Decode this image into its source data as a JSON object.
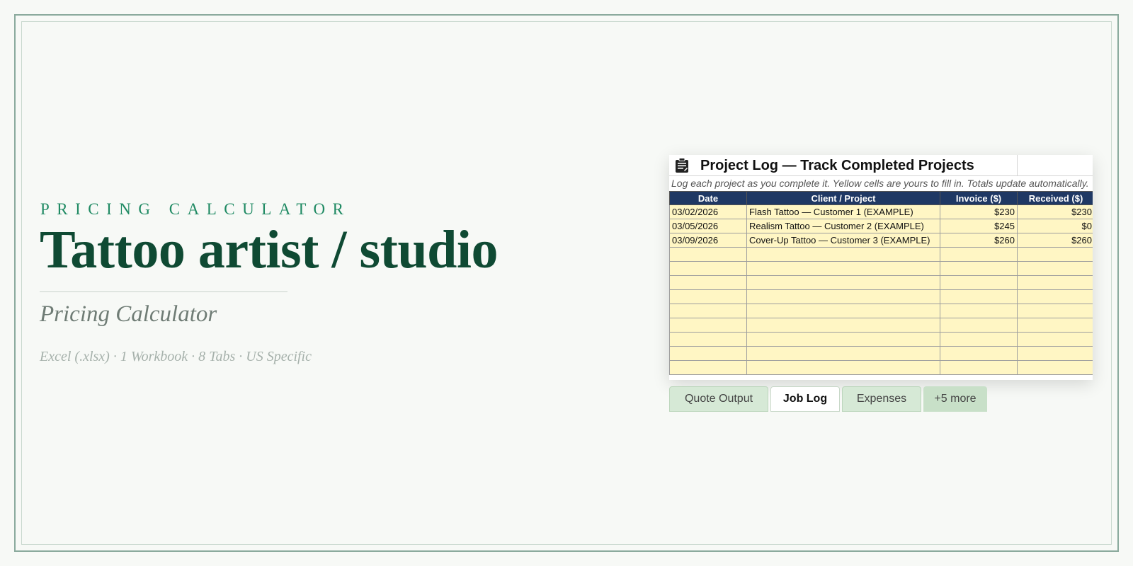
{
  "page": {
    "eyebrow": "PRICING CALCULATOR",
    "title": "Tattoo artist / studio",
    "subtitle": "Pricing Calculator",
    "meta": "Excel (.xlsx) · 1 Workbook · 8 Tabs · US Specific"
  },
  "sheet": {
    "icon": "clipboard-icon",
    "title": "Project Log — Track Completed Projects",
    "note": "Log each project as you complete it. Yellow cells are yours to fill in. Totals update automatically.",
    "headers": [
      "Date",
      "Client / Project",
      "Invoice ($)",
      "Received ($)"
    ],
    "rows": [
      [
        "03/02/2026",
        "Flash Tattoo — Customer 1 (EXAMPLE)",
        "$230",
        "$230"
      ],
      [
        "03/05/2026",
        "Realism Tattoo — Customer 2 (EXAMPLE)",
        "$245",
        "$0"
      ],
      [
        "03/09/2026",
        "Cover-Up Tattoo — Customer 3 (EXAMPLE)",
        "$260",
        "$260"
      ]
    ],
    "empty_rows": 9
  },
  "tabs": [
    {
      "label": "Quote Output",
      "active": false
    },
    {
      "label": "Job Log",
      "active": true
    },
    {
      "label": "Expenses",
      "active": false
    },
    {
      "label": "+5 more",
      "active": false
    }
  ],
  "colors": {
    "accent": "#1f8a63",
    "title": "#0f4a33",
    "header_fill": "#1f3864",
    "input_cell": "#fff6c4"
  }
}
